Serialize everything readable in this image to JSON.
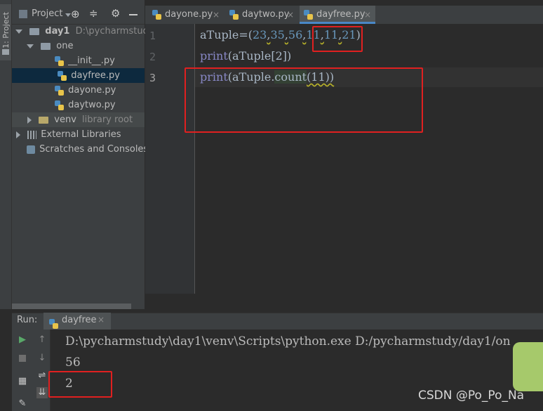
{
  "sidebar": {
    "vertical_tab_label": "1: Project"
  },
  "project": {
    "title": "Project",
    "tree": {
      "root_name": "day1",
      "root_path": "D:\\pycharmstudy\\da",
      "folder_one": "one",
      "files": [
        "__init__.py",
        "dayfree.py",
        "dayone.py",
        "daytwo.py"
      ],
      "venv": "venv",
      "venv_note": "library root",
      "external_libraries": "External Libraries",
      "scratches": "Scratches and Consoles"
    }
  },
  "tabs": [
    {
      "label": "dayone.py",
      "close": "×"
    },
    {
      "label": "daytwo.py",
      "close": "×"
    },
    {
      "label": "dayfree.py",
      "close": "×",
      "active": true
    }
  ],
  "editor": {
    "line_numbers": [
      "1",
      "2",
      "3"
    ],
    "lines": [
      "aTuple=(23,35,56,11,11,21)",
      "print(aTuple[2])",
      "print(aTuple.count(11))"
    ],
    "line1": {
      "prefix": "aTuple=(",
      "n1": "23",
      "n2": "35",
      "n3": "56",
      "n4": "11",
      "n5": "11",
      "n6": "21",
      "suffix": ")",
      "comma": ","
    },
    "line2": {
      "kw": "print",
      "rest": "(aTuple[2])"
    },
    "line3": {
      "kw": "print",
      "pre": "(aTuple.",
      "method": "count",
      "post": "(11))"
    }
  },
  "run": {
    "label": "Run:",
    "tab_label": "dayfree",
    "tab_close": "×",
    "console_lines": [
      "D:\\pycharmstudy\\day1\\venv\\Scripts\\python.exe D:/pycharmstudy/day1/on",
      "56",
      "2"
    ]
  },
  "watermark": "CSDN @Po_Po_Na",
  "colors": {
    "accent": "#4a88c7",
    "annotation_red": "#e02020",
    "number": "#6897bb",
    "keyword": "#8888c6"
  }
}
